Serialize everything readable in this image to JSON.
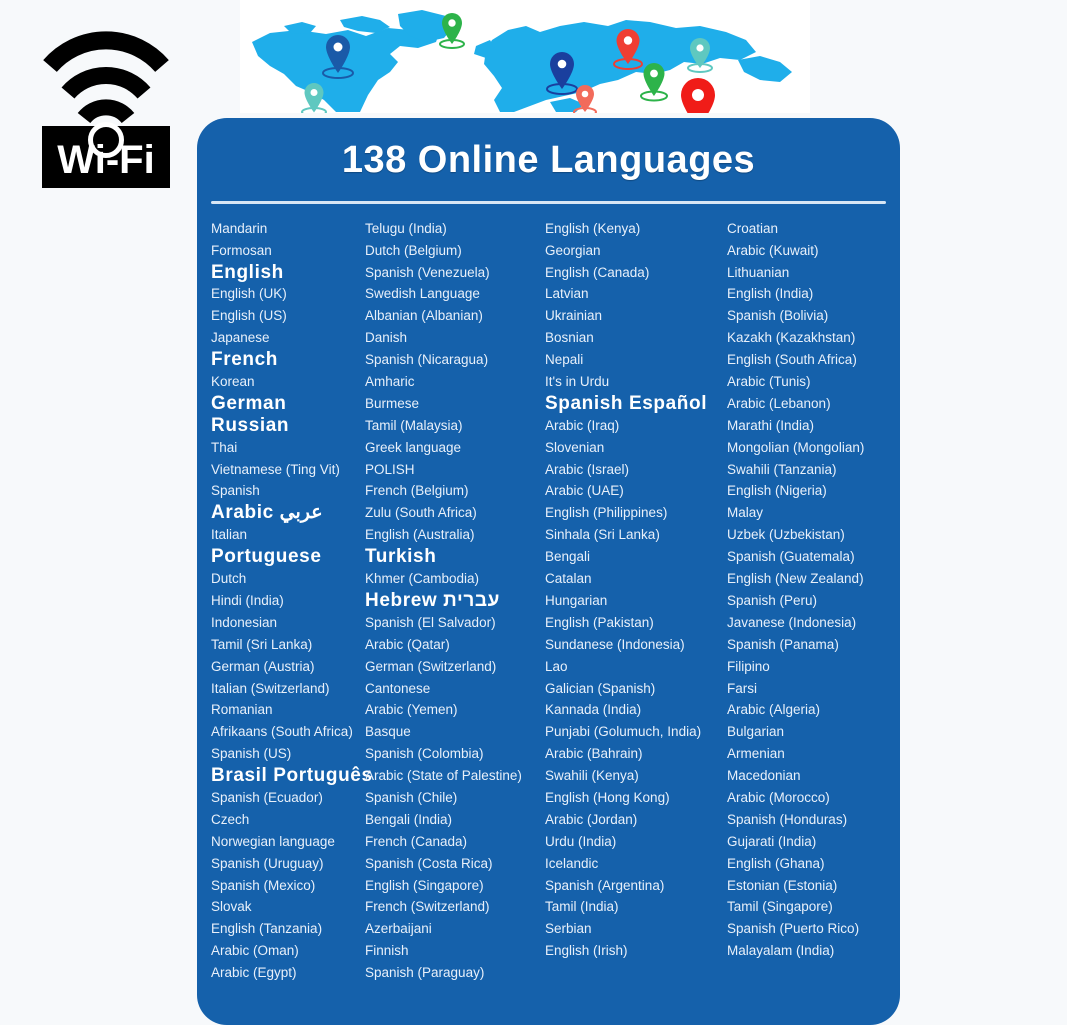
{
  "logo": {
    "name": "wifi-logo",
    "text": "Wi-Fi",
    "color": "#000000"
  },
  "banner": {
    "name": "world-map-banner",
    "land_color": "#1faeea",
    "background": "#ffffff",
    "pins": [
      {
        "label": "pin-north-america",
        "color": "#1a5aa8"
      },
      {
        "label": "pin-central-america",
        "color": "#5fc8c0"
      },
      {
        "label": "pin-greenland",
        "color": "#2db34a"
      },
      {
        "label": "pin-europe",
        "color": "#1a3f9e"
      },
      {
        "label": "pin-africa",
        "color": "#f26b5b"
      },
      {
        "label": "pin-russia-north",
        "color": "#ef3e33"
      },
      {
        "label": "pin-central-asia",
        "color": "#2db34a"
      },
      {
        "label": "pin-east-asia",
        "color": "#5fc8c0"
      },
      {
        "label": "pin-south-asia",
        "color": "#f01c18"
      }
    ]
  },
  "card": {
    "title": "138 Online Languages",
    "background_color": "#1561ab",
    "text_color": "#e8f0fa",
    "highlight_color": "#ffffff",
    "columns": [
      {
        "name": "language-column-1",
        "items": [
          {
            "label": "Mandarin",
            "emphasis": false
          },
          {
            "label": "Formosan",
            "emphasis": false
          },
          {
            "label": "English",
            "emphasis": true
          },
          {
            "label": "English (UK)",
            "emphasis": false
          },
          {
            "label": "English (US)",
            "emphasis": false
          },
          {
            "label": "Japanese",
            "emphasis": false
          },
          {
            "label": "French",
            "emphasis": true
          },
          {
            "label": "Korean",
            "emphasis": false
          },
          {
            "label": "German",
            "emphasis": true
          },
          {
            "label": "Russian",
            "emphasis": true
          },
          {
            "label": "Thai",
            "emphasis": false
          },
          {
            "label": "Vietnamese (Ting Vit)",
            "emphasis": false
          },
          {
            "label": "Spanish",
            "emphasis": false
          },
          {
            "label": "Arabic عربي",
            "emphasis": true
          },
          {
            "label": "Italian",
            "emphasis": false
          },
          {
            "label": "Portuguese",
            "emphasis": true
          },
          {
            "label": "Dutch",
            "emphasis": false
          },
          {
            "label": "Hindi (India)",
            "emphasis": false
          },
          {
            "label": "Indonesian",
            "emphasis": false
          },
          {
            "label": "Tamil (Sri Lanka)",
            "emphasis": false
          },
          {
            "label": "German (Austria)",
            "emphasis": false
          },
          {
            "label": "Italian (Switzerland)",
            "emphasis": false
          },
          {
            "label": "Romanian",
            "emphasis": false
          },
          {
            "label": "Afrikaans (South Africa)",
            "emphasis": false
          },
          {
            "label": "Spanish (US)",
            "emphasis": false
          },
          {
            "label": "Brasil Português",
            "emphasis": true
          },
          {
            "label": "Spanish (Ecuador)",
            "emphasis": false
          },
          {
            "label": "Czech",
            "emphasis": false
          },
          {
            "label": "Norwegian language",
            "emphasis": false
          },
          {
            "label": "Spanish (Uruguay)",
            "emphasis": false
          },
          {
            "label": "Spanish (Mexico)",
            "emphasis": false
          },
          {
            "label": "Slovak",
            "emphasis": false
          },
          {
            "label": "English (Tanzania)",
            "emphasis": false
          },
          {
            "label": "Arabic (Oman)",
            "emphasis": false
          },
          {
            "label": "Arabic (Egypt)",
            "emphasis": false
          }
        ]
      },
      {
        "name": "language-column-2",
        "items": [
          {
            "label": "Telugu (India)",
            "emphasis": false
          },
          {
            "label": "Dutch (Belgium)",
            "emphasis": false
          },
          {
            "label": "Spanish (Venezuela)",
            "emphasis": false
          },
          {
            "label": "Swedish Language",
            "emphasis": false
          },
          {
            "label": "Albanian (Albanian)",
            "emphasis": false
          },
          {
            "label": "Danish",
            "emphasis": false
          },
          {
            "label": "Spanish (Nicaragua)",
            "emphasis": false
          },
          {
            "label": "Amharic",
            "emphasis": false
          },
          {
            "label": "Burmese",
            "emphasis": false
          },
          {
            "label": "Tamil (Malaysia)",
            "emphasis": false
          },
          {
            "label": "Greek language",
            "emphasis": false
          },
          {
            "label": "POLISH",
            "emphasis": false
          },
          {
            "label": "French (Belgium)",
            "emphasis": false
          },
          {
            "label": "Zulu (South Africa)",
            "emphasis": false
          },
          {
            "label": "English (Australia)",
            "emphasis": false
          },
          {
            "label": "Turkish",
            "emphasis": true
          },
          {
            "label": "Khmer (Cambodia)",
            "emphasis": false
          },
          {
            "label": "Hebrew עברית",
            "emphasis": true
          },
          {
            "label": "Spanish (El Salvador)",
            "emphasis": false
          },
          {
            "label": "Arabic (Qatar)",
            "emphasis": false
          },
          {
            "label": "German (Switzerland)",
            "emphasis": false
          },
          {
            "label": "Cantonese",
            "emphasis": false
          },
          {
            "label": "Arabic (Yemen)",
            "emphasis": false
          },
          {
            "label": "Basque",
            "emphasis": false
          },
          {
            "label": "Spanish (Colombia)",
            "emphasis": false
          },
          {
            "label": "Arabic (State of Palestine)",
            "emphasis": false
          },
          {
            "label": "Spanish (Chile)",
            "emphasis": false
          },
          {
            "label": "Bengali (India)",
            "emphasis": false
          },
          {
            "label": "French (Canada)",
            "emphasis": false
          },
          {
            "label": "Spanish (Costa Rica)",
            "emphasis": false
          },
          {
            "label": "English (Singapore)",
            "emphasis": false
          },
          {
            "label": "French (Switzerland)",
            "emphasis": false
          },
          {
            "label": "Azerbaijani",
            "emphasis": false
          },
          {
            "label": "Finnish",
            "emphasis": false
          },
          {
            "label": "Spanish (Paraguay)",
            "emphasis": false
          }
        ]
      },
      {
        "name": "language-column-3",
        "items": [
          {
            "label": "English (Kenya)",
            "emphasis": false
          },
          {
            "label": "Georgian",
            "emphasis": false
          },
          {
            "label": "English (Canada)",
            "emphasis": false
          },
          {
            "label": "Latvian",
            "emphasis": false
          },
          {
            "label": "Ukrainian",
            "emphasis": false
          },
          {
            "label": "Bosnian",
            "emphasis": false
          },
          {
            "label": "Nepali",
            "emphasis": false
          },
          {
            "label": "It's in Urdu",
            "emphasis": false
          },
          {
            "label": "Spanish Español",
            "emphasis": true
          },
          {
            "label": "Arabic (Iraq)",
            "emphasis": false
          },
          {
            "label": "Slovenian",
            "emphasis": false
          },
          {
            "label": "Arabic (Israel)",
            "emphasis": false
          },
          {
            "label": "Arabic (UAE)",
            "emphasis": false
          },
          {
            "label": "English (Philippines)",
            "emphasis": false
          },
          {
            "label": "Sinhala (Sri Lanka)",
            "emphasis": false
          },
          {
            "label": "Bengali",
            "emphasis": false
          },
          {
            "label": "Catalan",
            "emphasis": false
          },
          {
            "label": "Hungarian",
            "emphasis": false
          },
          {
            "label": "English (Pakistan)",
            "emphasis": false
          },
          {
            "label": "Sundanese (Indonesia)",
            "emphasis": false
          },
          {
            "label": "Lao",
            "emphasis": false
          },
          {
            "label": "Galician (Spanish)",
            "emphasis": false
          },
          {
            "label": "Kannada (India)",
            "emphasis": false
          },
          {
            "label": "Punjabi (Golumuch, India)",
            "emphasis": false
          },
          {
            "label": "Arabic (Bahrain)",
            "emphasis": false
          },
          {
            "label": "Swahili (Kenya)",
            "emphasis": false
          },
          {
            "label": "English (Hong Kong)",
            "emphasis": false
          },
          {
            "label": "Arabic (Jordan)",
            "emphasis": false
          },
          {
            "label": "Urdu (India)",
            "emphasis": false
          },
          {
            "label": "Icelandic",
            "emphasis": false
          },
          {
            "label": "Spanish (Argentina)",
            "emphasis": false
          },
          {
            "label": "Tamil (India)",
            "emphasis": false
          },
          {
            "label": "Serbian",
            "emphasis": false
          },
          {
            "label": "English (Irish)",
            "emphasis": false
          }
        ]
      },
      {
        "name": "language-column-4",
        "items": [
          {
            "label": "Croatian",
            "emphasis": false
          },
          {
            "label": "Arabic (Kuwait)",
            "emphasis": false
          },
          {
            "label": "Lithuanian",
            "emphasis": false
          },
          {
            "label": "English (India)",
            "emphasis": false
          },
          {
            "label": "Spanish (Bolivia)",
            "emphasis": false
          },
          {
            "label": "Kazakh (Kazakhstan)",
            "emphasis": false
          },
          {
            "label": "English (South Africa)",
            "emphasis": false
          },
          {
            "label": "Arabic (Tunis)",
            "emphasis": false
          },
          {
            "label": "Arabic (Lebanon)",
            "emphasis": false
          },
          {
            "label": "Marathi (India)",
            "emphasis": false
          },
          {
            "label": "Mongolian (Mongolian)",
            "emphasis": false
          },
          {
            "label": "Swahili (Tanzania)",
            "emphasis": false
          },
          {
            "label": "English (Nigeria)",
            "emphasis": false
          },
          {
            "label": "Malay",
            "emphasis": false
          },
          {
            "label": "Uzbek (Uzbekistan)",
            "emphasis": false
          },
          {
            "label": "Spanish (Guatemala)",
            "emphasis": false
          },
          {
            "label": "English (New Zealand)",
            "emphasis": false
          },
          {
            "label": "Spanish (Peru)",
            "emphasis": false
          },
          {
            "label": "Javanese (Indonesia)",
            "emphasis": false
          },
          {
            "label": "Spanish (Panama)",
            "emphasis": false
          },
          {
            "label": "Filipino",
            "emphasis": false
          },
          {
            "label": "Farsi",
            "emphasis": false
          },
          {
            "label": "Arabic (Algeria)",
            "emphasis": false
          },
          {
            "label": "Bulgarian",
            "emphasis": false
          },
          {
            "label": "Armenian",
            "emphasis": false
          },
          {
            "label": "Macedonian",
            "emphasis": false
          },
          {
            "label": "Arabic (Morocco)",
            "emphasis": false
          },
          {
            "label": "Spanish (Honduras)",
            "emphasis": false
          },
          {
            "label": "Gujarati (India)",
            "emphasis": false
          },
          {
            "label": "English (Ghana)",
            "emphasis": false
          },
          {
            "label": "Estonian (Estonia)",
            "emphasis": false
          },
          {
            "label": "Tamil (Singapore)",
            "emphasis": false
          },
          {
            "label": "Spanish (Puerto Rico)",
            "emphasis": false
          },
          {
            "label": "Malayalam (India)",
            "emphasis": false
          }
        ]
      }
    ]
  }
}
